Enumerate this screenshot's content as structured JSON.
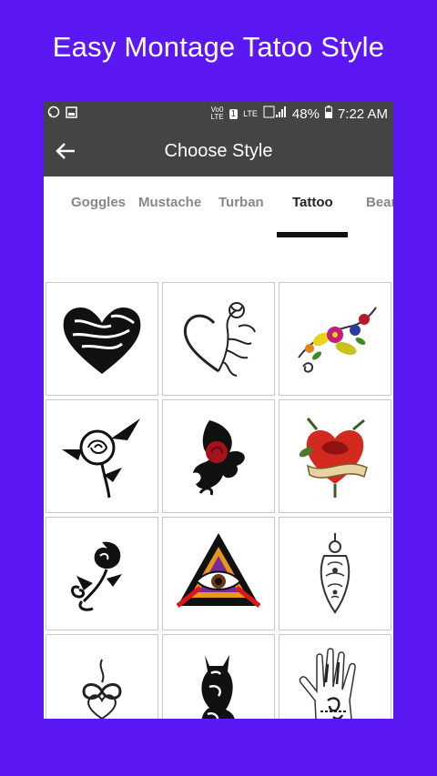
{
  "promo": {
    "title": "Easy Montage Tatoo Style"
  },
  "status_bar": {
    "network": "Vo0 LTE",
    "sim": "1",
    "lte": "LTE",
    "battery": "48%",
    "time": "7:22 AM"
  },
  "app_bar": {
    "title": "Choose Style"
  },
  "tabs": [
    {
      "label": "Goggles"
    },
    {
      "label": "Mustache"
    },
    {
      "label": "Turban"
    },
    {
      "label": "Tattoo",
      "active": true
    },
    {
      "label": "Bear"
    }
  ],
  "colors": {
    "background": "#5b18f2",
    "appbar": "#444444",
    "indicator": "#111111"
  },
  "tattoos": [
    {
      "icon": "tribal-heart-icon"
    },
    {
      "icon": "heart-rose-vine-icon"
    },
    {
      "icon": "colorful-floral-icon"
    },
    {
      "icon": "black-rose-stem-icon"
    },
    {
      "icon": "tribal-red-rose-icon"
    },
    {
      "icon": "rose-heart-banner-icon"
    },
    {
      "icon": "rose-swirl-icon"
    },
    {
      "icon": "all-seeing-eye-triangle-icon"
    },
    {
      "icon": "mandala-pendant-icon"
    },
    {
      "icon": "infinity-heart-icon"
    },
    {
      "icon": "tribal-cat-icon"
    },
    {
      "icon": "hand-henna-icon"
    }
  ]
}
